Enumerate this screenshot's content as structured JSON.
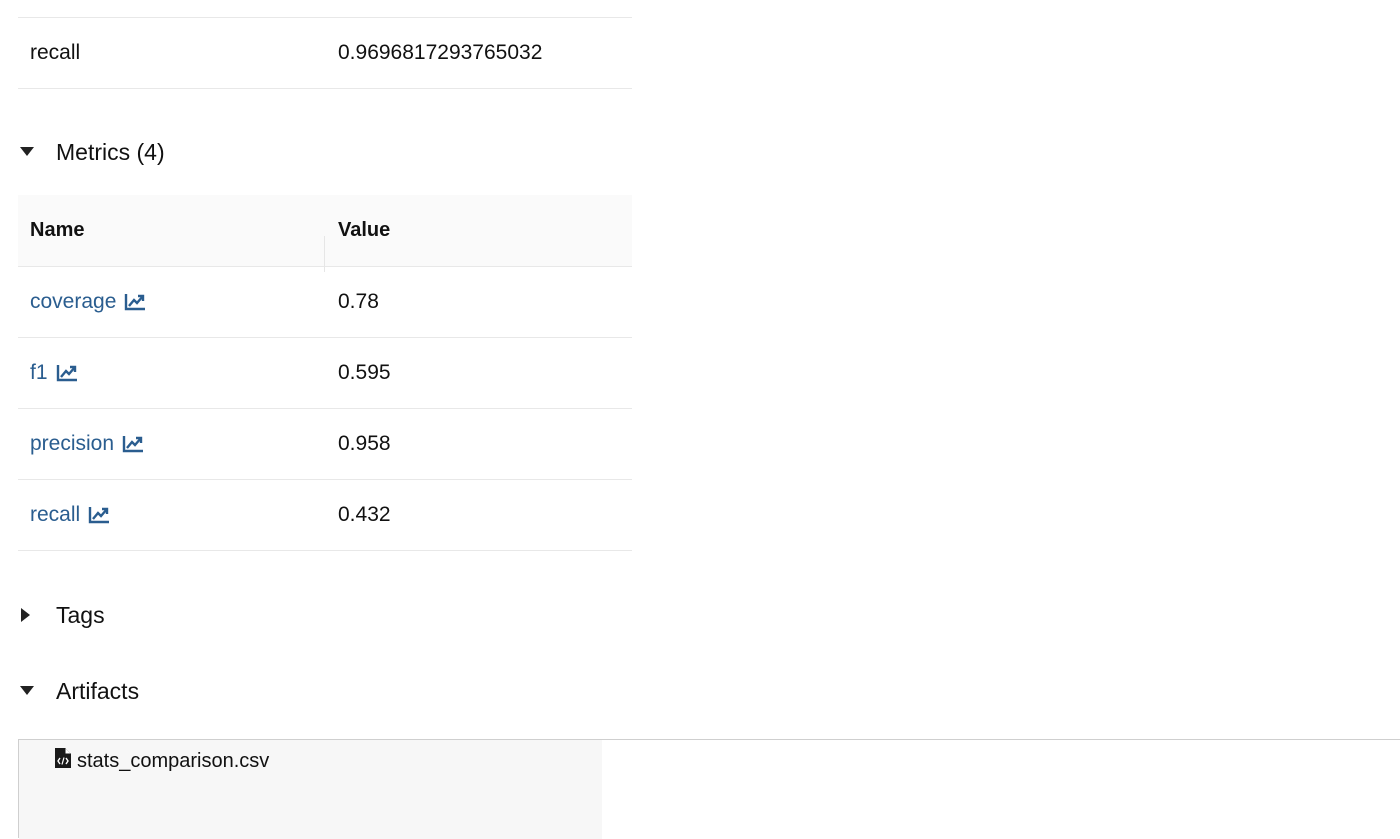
{
  "parameters": {
    "rows": [
      {
        "name": "recall",
        "value": "0.9696817293765032"
      }
    ]
  },
  "metrics": {
    "title": "Metrics (4)",
    "expanded": true,
    "columns": {
      "name": "Name",
      "value": "Value"
    },
    "rows": [
      {
        "name": "coverage",
        "value": "0.78",
        "icon": "line-chart-icon"
      },
      {
        "name": "f1",
        "value": "0.595",
        "icon": "line-chart-icon"
      },
      {
        "name": "precision",
        "value": "0.958",
        "icon": "line-chart-icon"
      },
      {
        "name": "recall",
        "value": "0.432",
        "icon": "line-chart-icon"
      }
    ]
  },
  "tags": {
    "title": "Tags",
    "expanded": false
  },
  "artifacts": {
    "title": "Artifacts",
    "expanded": true,
    "files": [
      {
        "name": "stats_comparison.csv",
        "icon": "file-code-icon"
      }
    ]
  },
  "colors": {
    "link": "#2a5d8f",
    "border": "#e8e8e8",
    "header_bg": "#fafafa"
  }
}
